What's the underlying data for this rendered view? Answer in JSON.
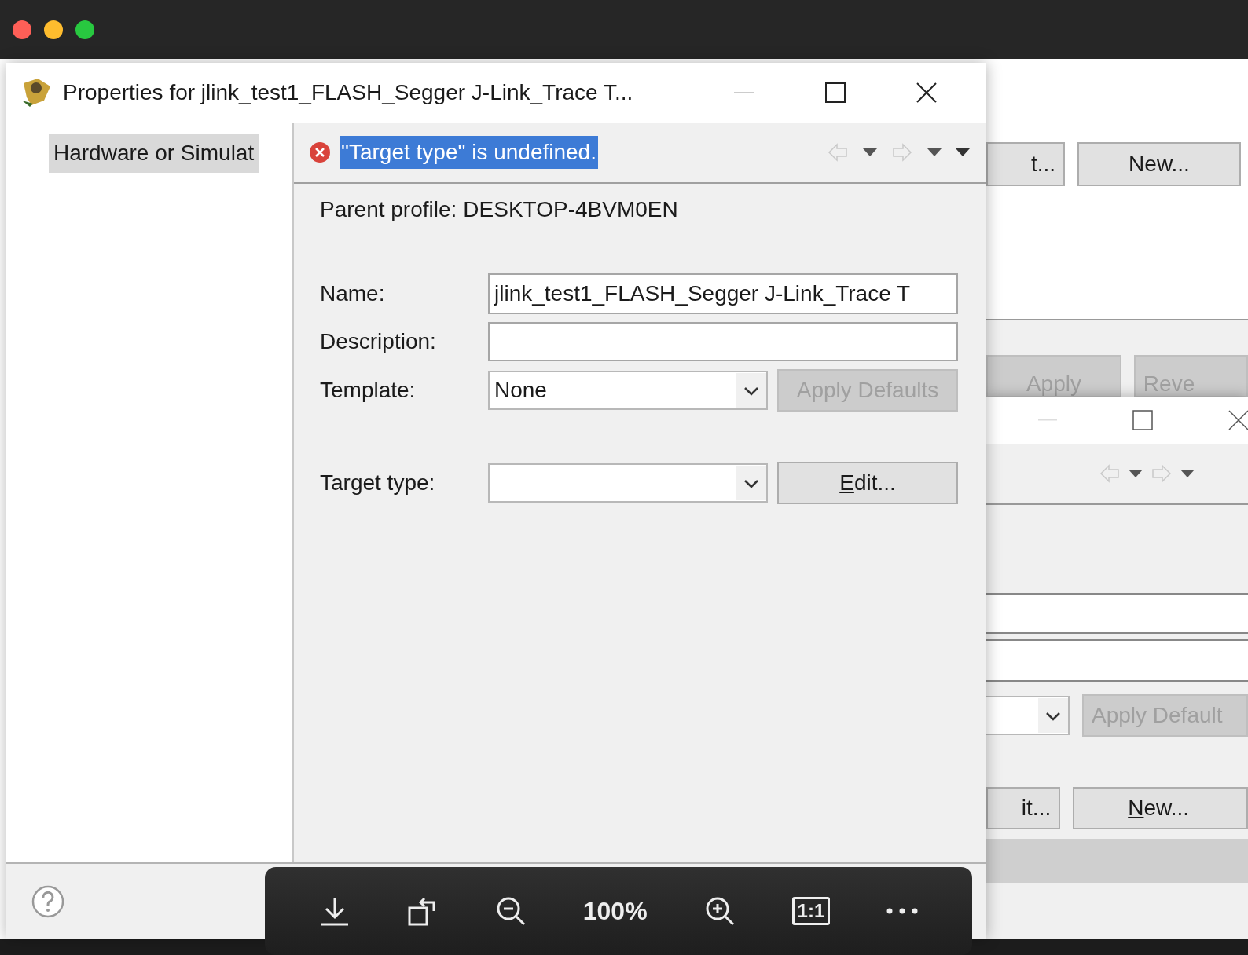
{
  "dialog": {
    "title": "Properties for jlink_test1_FLASH_Segger J-Link_Trace T...",
    "sidebar": {
      "items": [
        {
          "label": "Hardware or Simulat",
          "selected": true
        }
      ]
    },
    "message": {
      "kind": "error",
      "text": "\"Target type\" is undefined.",
      "selected": true
    },
    "parent_profile": {
      "label": "Parent profile:",
      "value": "DESKTOP-4BVM0EN"
    },
    "fields": [
      {
        "kind": "text",
        "label": "Name:",
        "value": "jlink_test1_FLASH_Segger J-Link_Trace T"
      },
      {
        "kind": "text",
        "label": "Description:"
      },
      {
        "kind": "select",
        "label": "Template:",
        "value": "None",
        "button": {
          "label": "Apply Defaults",
          "disabled": true,
          "underline_first": false
        }
      },
      {
        "kind": "select",
        "label": "Target type:",
        "button": {
          "label": "Edit...",
          "disabled": false,
          "underline_first": true
        }
      }
    ]
  },
  "background_window": {
    "top_buttons": [
      {
        "label": "t...",
        "disabled": false
      },
      {
        "label": "New...",
        "disabled": false
      }
    ],
    "bottom_buttons": [
      {
        "label": "Apply",
        "disabled": true
      },
      {
        "label": "Reve",
        "disabled": true
      }
    ]
  },
  "second_window": {
    "apply_defaults": {
      "label": "Apply Default",
      "disabled": true
    },
    "buttons": [
      {
        "label": "it...",
        "underline_first": false
      },
      {
        "label": "New...",
        "underline_first": true
      }
    ]
  },
  "viewer": {
    "zoom": "100%",
    "actual_size": "1:1"
  }
}
